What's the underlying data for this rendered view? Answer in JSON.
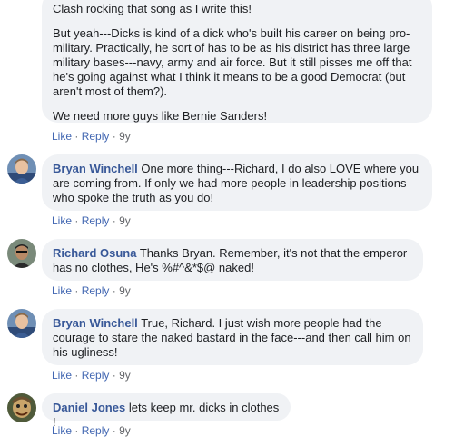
{
  "comments": [
    {
      "paragraphs": [
        "Clash rocking that song as I write this!",
        "But yeah---Dicks is kind of a dick who's built his career on being pro-military. Practically, he sort of has to be as his district has three large military bases---navy, army and air force. But it still pisses me off that he's going against what I think it means to be a good Democrat (but aren't most of them?).",
        "We need more guys like Bernie Sanders!"
      ],
      "actions": {
        "like": "Like",
        "reply": "Reply",
        "time": "9y"
      }
    },
    {
      "author": "Bryan Winchell",
      "text": "One more thing---Richard, I do also LOVE where you are coming from. If only we had more people in leadership positions who spoke the truth as you do!",
      "actions": {
        "like": "Like",
        "reply": "Reply",
        "time": "9y"
      }
    },
    {
      "author": "Richard Osuna",
      "text": "Thanks Bryan. Remember, it's not that the emperor has no clothes, He's %#^&*$@ naked!",
      "actions": {
        "like": "Like",
        "reply": "Reply",
        "time": "9y"
      }
    },
    {
      "author": "Bryan Winchell",
      "text": "True, Richard. I just wish more people had the courage to stare the naked bastard in the face---and then call him on his ugliness!",
      "actions": {
        "like": "Like",
        "reply": "Reply",
        "time": "9y"
      }
    },
    {
      "author": "Daniel Jones",
      "text": "lets keep mr. dicks in clothes !",
      "actions": {
        "like": "Like",
        "reply": "Reply",
        "time": "9y"
      }
    }
  ],
  "separator": "·",
  "colors": {
    "link": "#385898",
    "action": "#4267b2",
    "bubble": "#f0f2f5",
    "meta": "#65676b"
  }
}
